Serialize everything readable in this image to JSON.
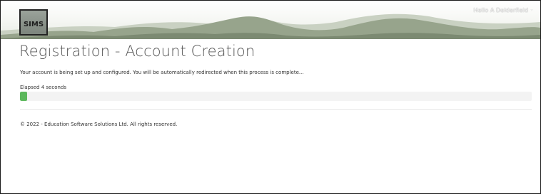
{
  "header": {
    "logo_text": "SIMS",
    "greeting": "Hello A Delderfield"
  },
  "main": {
    "title": "Registration - Account Creation",
    "message": "Your account is being set up and configured. You will be automatically redirected when this process is complete...",
    "elapsed": "Elapsed 4 seconds",
    "progress_fraction": 0.014
  },
  "footer": {
    "copyright": "© 2022 - Education Software Solutions Ltd. All rights reserved."
  },
  "colors": {
    "progress": "#5cb85c",
    "title": "#555555"
  }
}
